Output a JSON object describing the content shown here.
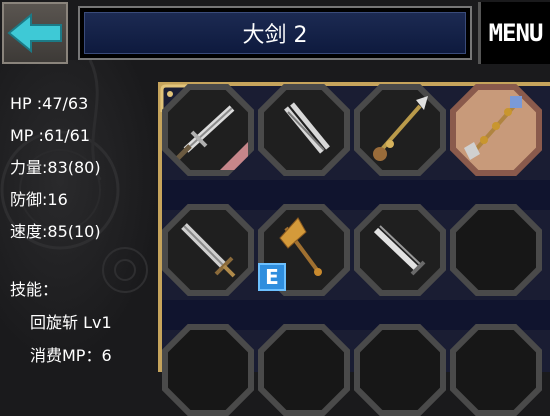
{
  "header": {
    "title": "大剑 2",
    "menu_label": "MENU"
  },
  "stats": {
    "hp": "HP :47/63",
    "mp": "MP :61/61",
    "strength": "力量:83(80)",
    "defense": "防御:16",
    "speed": "速度:85(10)"
  },
  "skills": {
    "heading": "技能：",
    "skill_name": "回旋斩 Lv1",
    "skill_cost": "消费MP：6"
  },
  "inventory": {
    "equipped_badge": "E",
    "slots": [
      {
        "item": "greatsword-icon",
        "state": "normal"
      },
      {
        "item": "twin-blade-icon",
        "state": "normal"
      },
      {
        "item": "golden-spear-icon",
        "state": "normal"
      },
      {
        "item": "ornate-mace-icon",
        "state": "selected"
      },
      {
        "item": "broadsword-icon",
        "state": "normal"
      },
      {
        "item": "golden-axe-icon",
        "state": "equipped"
      },
      {
        "item": "serrated-sword-icon",
        "state": "normal"
      },
      {
        "item": "",
        "state": "empty"
      }
    ]
  },
  "colors": {
    "accent_cyan": "#3ec9d6",
    "panel_gold": "#c6a45c",
    "title_navy": "#1c2a52",
    "selected_slot": "#c89a7a",
    "equipped_badge": "#2f8ede"
  }
}
